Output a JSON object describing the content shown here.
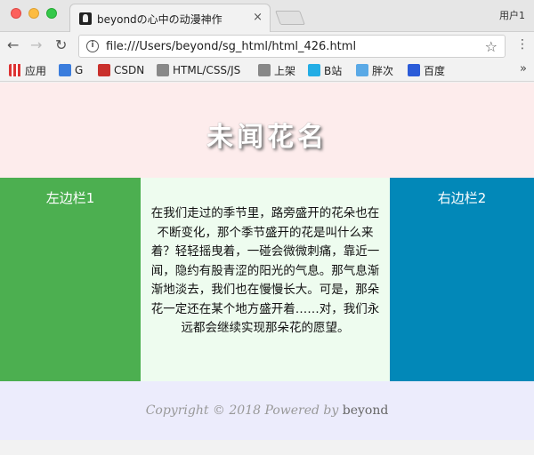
{
  "browser": {
    "tab_title": "beyondの心中の动漫神作",
    "tab_close": "×",
    "user_label": "用户1",
    "url": "file:///Users/beyond/sg_html/html_426.html",
    "bookmarks": [
      "应用",
      "G",
      "CSDN",
      "HTML/CSS/JS",
      "上架",
      "B站",
      "胖次",
      "百度"
    ],
    "bookmarks_more": "»"
  },
  "page": {
    "header_title": "未闻花名",
    "left_sidebar_title": "左边栏1",
    "right_sidebar_title": "右边栏2",
    "content": "在我们走过的季节里，路旁盛开的花朵也在不断变化，那个季节盛开的花是叫什么来着？轻轻摇曳着，一碰会微微刺痛，靠近一闻，隐约有股青涩的阳光的气息。那气息渐渐地淡去，我们也在慢慢长大。可是，那朵花一定还在某个地方盛开着……对，我们永远都会继续实现那朵花的愿望。",
    "footer": {
      "copyright_label": "Copyright © 2018",
      "powered_label": "Powered by",
      "author": "beyond"
    }
  },
  "colors": {
    "header_bg": "#fdecec",
    "left_sidebar_bg": "#4caf50",
    "right_sidebar_bg": "#0288b8",
    "content_bg": "#eefcef",
    "footer_bg": "#ececfc"
  }
}
